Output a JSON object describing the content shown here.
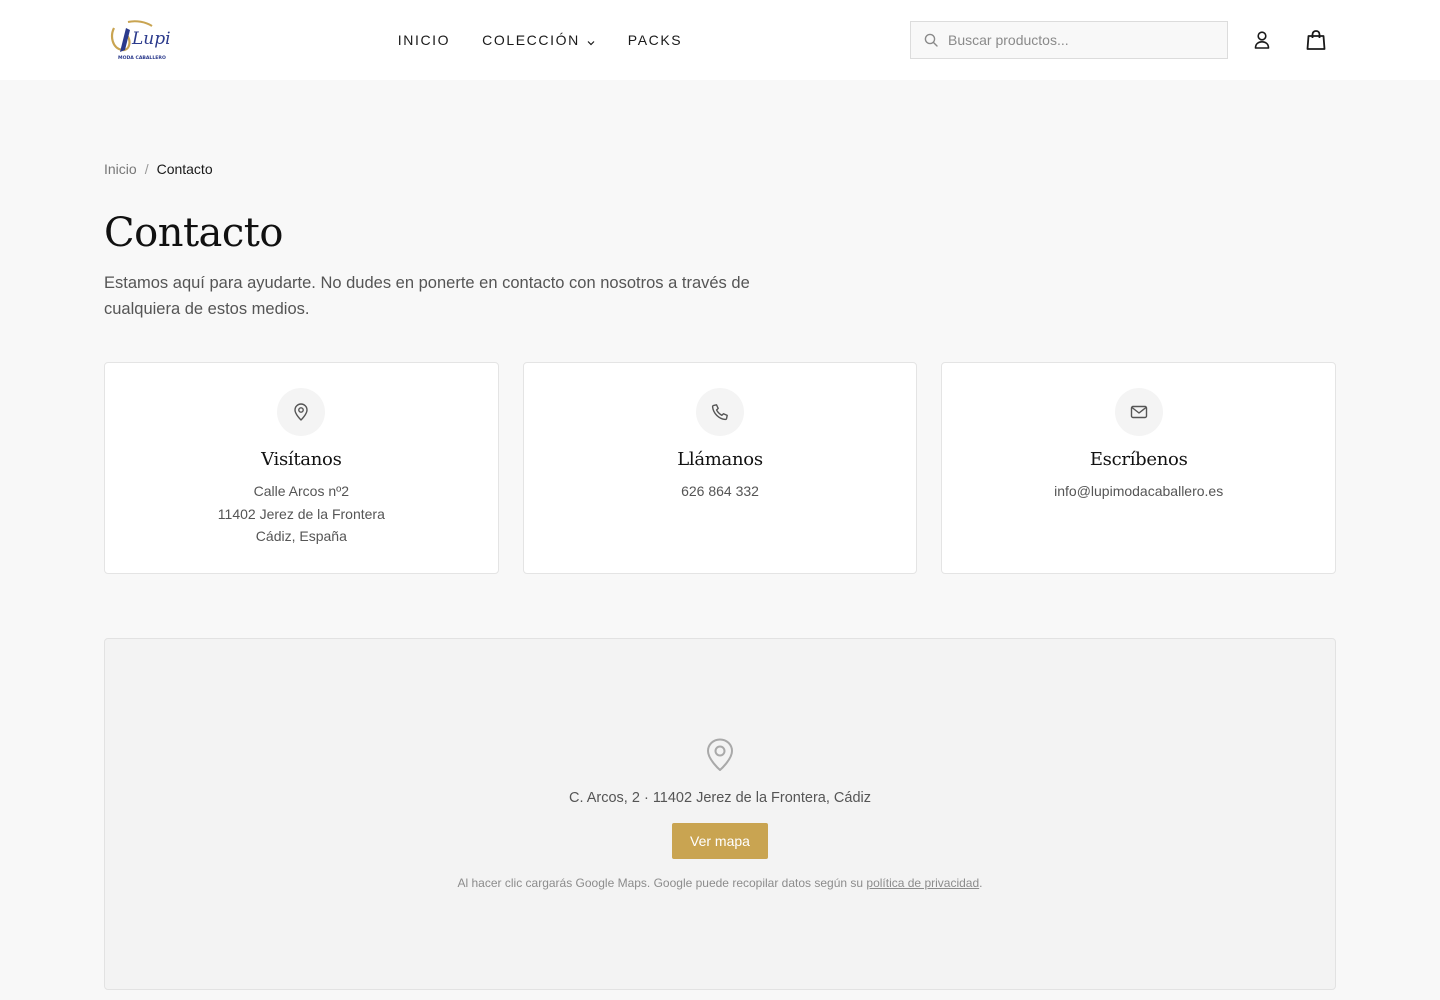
{
  "brand": {
    "logo_text": "Lupi",
    "logo_subtext": "MODA CABALLERO"
  },
  "header": {
    "nav": [
      {
        "label": "INICIO"
      },
      {
        "label": "COLECCIÓN"
      },
      {
        "label": "PACKS"
      }
    ],
    "search_placeholder": "Buscar productos...",
    "icons": [
      "search-icon",
      "user-icon",
      "shopping-bag-icon",
      "chevron-down-icon"
    ]
  },
  "breadcrumb": {
    "home": "Inicio",
    "separator": "/",
    "current": "Contacto"
  },
  "page": {
    "title": "Contacto",
    "intro": "Estamos aquí para ayudarte. No dudes en ponerte en contacto con nosotros a través de cualquiera de estos medios."
  },
  "cards": [
    {
      "icon": "map-pin-icon",
      "title": "Visítanos",
      "lines": [
        "Calle Arcos nº2",
        "11402 Jerez de la Frontera",
        "Cádiz, España"
      ]
    },
    {
      "icon": "phone-icon",
      "title": "Llámanos",
      "lines": [
        "626 864 332"
      ]
    },
    {
      "icon": "mail-icon",
      "title": "Escríbenos",
      "lines": [
        "info@lupimodacaballero.es"
      ]
    }
  ],
  "map": {
    "address": "C. Arcos, 2 · 11402 Jerez de la Frontera, Cádiz",
    "button_label": "Ver mapa",
    "note_prefix": "Al hacer clic cargarás Google Maps. Google puede recopilar datos según su ",
    "note_link": "política de privacidad",
    "note_suffix": "."
  },
  "colors": {
    "accent": "#c9a451",
    "brand_blue": "#2b3a8c",
    "page_bg": "#f8f8f8"
  }
}
